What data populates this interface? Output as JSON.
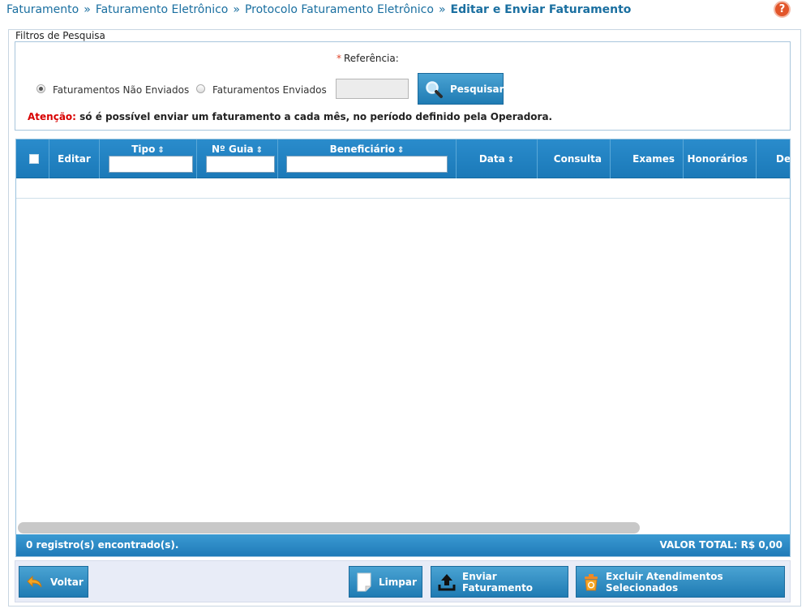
{
  "breadcrumb": {
    "items": [
      "Faturamento",
      "Faturamento Eletrônico",
      "Protocolo Faturamento Eletrônico"
    ],
    "separator": "»",
    "current": "Editar e Enviar Faturamento"
  },
  "help": {
    "icon": "question-icon",
    "glyph": "?"
  },
  "filters": {
    "legend": "Filtros de Pesquisa",
    "required_mark": "*",
    "referencia_label": "Referência:",
    "referencia_value": "",
    "radio_nao_enviados": "Faturamentos Não Enviados",
    "radio_enviados": "Faturamentos Enviados",
    "selected_radio": "Faturamentos Não Enviados",
    "search_button": "Pesquisar",
    "warning_lead": "Atenção:",
    "warning_text": " só é possível enviar um faturamento a cada mês, no período definido pela Operadora."
  },
  "grid": {
    "columns": [
      "Editar",
      "Tipo",
      "Nº Guia",
      "Beneficiário",
      "Data",
      "Consulta",
      "Exames",
      "Honorários",
      "De"
    ],
    "sort_glyph": "⇕",
    "rows": [],
    "footer_count": "0 registro(s) encontrado(s).",
    "footer_total": "VALOR TOTAL: R$ 0,00"
  },
  "toolbar": {
    "back": "Voltar",
    "clear": "Limpar",
    "send": "Enviar Faturamento",
    "delete_selected": "Excluir Atendimentos Selecionados"
  },
  "colors": {
    "link": "#1a6fa0",
    "header_blue": "#1f7bb3",
    "warning_red": "#d80000",
    "help_orange": "#e2552a"
  }
}
